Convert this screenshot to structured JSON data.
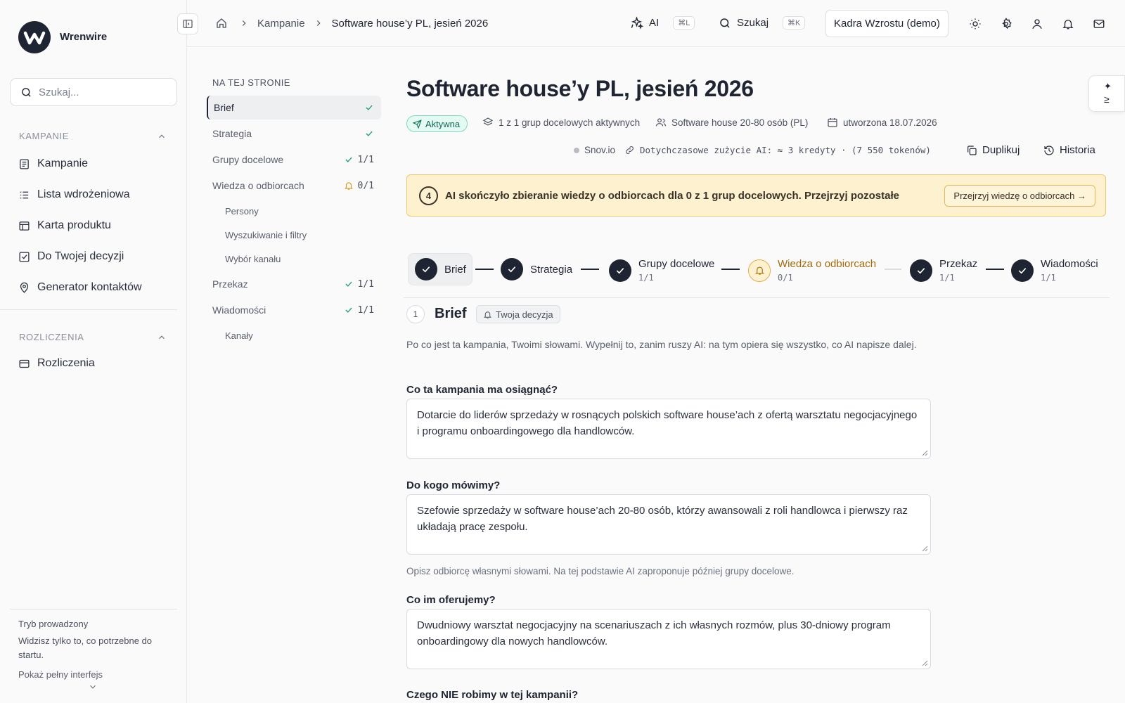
{
  "app": {
    "brand": "Wrenwire"
  },
  "sidebar": {
    "search_placeholder": "Szukaj...",
    "sections": [
      {
        "title": "KAMPANIE",
        "items": [
          {
            "label": "Kampanie",
            "icon": "list-doc-icon"
          },
          {
            "label": "Lista wdrożeniowa",
            "icon": "checklist-icon"
          },
          {
            "label": "Karta produktu",
            "icon": "layout-icon"
          },
          {
            "label": "Do Twojej decyzji",
            "icon": "checkbox-icon"
          },
          {
            "label": "Generator kontaktów",
            "icon": "location-pin-icon"
          }
        ]
      },
      {
        "title": "ROZLICZENIA",
        "items": [
          {
            "label": "Rozliczenia",
            "icon": "credit-card-icon"
          }
        ]
      }
    ],
    "footer": {
      "title": "Tryb prowadzony",
      "description": "Widzisz tylko to, co potrzebne do startu.",
      "link": "Pokaż pełny interfejs"
    }
  },
  "topbar": {
    "breadcrumb": [
      "Kampanie",
      "Software house’y PL, jesień 2026"
    ],
    "ai_label": "AI",
    "ai_shortcut": "⌘L",
    "search_label": "Szukaj",
    "search_shortcut": "⌘K",
    "org": "Kadra Wzrostu (demo)"
  },
  "toc": {
    "title": "NA TEJ STRONIE",
    "items": [
      {
        "label": "Brief",
        "status": "check",
        "count": ""
      },
      {
        "label": "Strategia",
        "status": "check",
        "count": ""
      },
      {
        "label": "Grupy docelowe",
        "status": "check",
        "count": "1/1"
      },
      {
        "label": "Wiedza o odbiorcach",
        "status": "bell",
        "count": "0/1"
      },
      {
        "label": "Persony",
        "status": "",
        "count": ""
      },
      {
        "label": "Wyszukiwanie i filtry",
        "status": "",
        "count": ""
      },
      {
        "label": "Wybór kanału",
        "status": "",
        "count": ""
      },
      {
        "label": "Przekaz",
        "status": "check",
        "count": "1/1"
      },
      {
        "label": "Wiadomości",
        "status": "check",
        "count": "1/1"
      },
      {
        "label": "Kanały",
        "status": "",
        "count": ""
      }
    ]
  },
  "campaign": {
    "title": "Software house’y PL, jesień 2026",
    "status": "Aktywna",
    "groups": "1 z 1 grup docelowych aktywnych",
    "segment": "Software house 20-80 osób (PL)",
    "created": "utworzona 18.07.2026",
    "integration": "Snov.io",
    "ai_usage": "Dotychczasowe zużycie AI: ≈ 3 kredyty · (7 550 tokenów)",
    "duplicate": "Duplikuj",
    "history": "Historia"
  },
  "alert": {
    "number": "4",
    "text": "AI skończyło zbieranie wiedzy o odbiorcach dla 0 z 1 grup docelowych. Przejrzyj pozostałe",
    "button": "Przejrzyj wiedzę o odbiorcach →"
  },
  "steps": [
    {
      "label": "Brief",
      "sub": ""
    },
    {
      "label": "Strategia",
      "sub": ""
    },
    {
      "label": "Grupy docelowe",
      "sub": "1/1"
    },
    {
      "label": "Wiedza o odbiorcach",
      "sub": "0/1"
    },
    {
      "label": "Przekaz",
      "sub": "1/1"
    },
    {
      "label": "Wiadomości",
      "sub": "1/1"
    }
  ],
  "brief": {
    "number": "1",
    "title": "Brief",
    "tag": "Twoja decyzja",
    "description": "Po co jest ta kampania, Twoimi słowami. Wypełnij to, zanim ruszy AI: na tym opiera się wszystko, co AI napisze dalej.",
    "fields": [
      {
        "question": "Co ta kampania ma osiągnąć?",
        "value": "Dotarcie do liderów sprzedaży w rosnących polskich software house’ach z ofertą warsztatu negocjacyjnego i programu onboardingowego dla handlowców.",
        "hint": ""
      },
      {
        "question": "Do kogo mówimy?",
        "value": "Szefowie sprzedaży w software house’ach 20-80 osób, którzy awansowali z roli handlowca i pierwszy raz układają pracę zespołu.",
        "hint": "Opisz odbiorcę własnymi słowami. Na tej podstawie AI zaproponuje później grupy docelowe."
      },
      {
        "question": "Co im oferujemy?",
        "value": "Dwudniowy warsztat negocjacyjny na scenariuszach z ich własnych rozmów, plus 30-dniowy program onboardingowy dla nowych handlowców.",
        "hint": ""
      },
      {
        "question": "Czego NIE robimy w tej kampanii?",
        "value": "",
        "hint": ""
      }
    ]
  },
  "colors": {
    "accent": "#1f2433",
    "success": "#22a06b",
    "warning": "#e0b14a",
    "alert_bg": "#fdf1cf"
  }
}
